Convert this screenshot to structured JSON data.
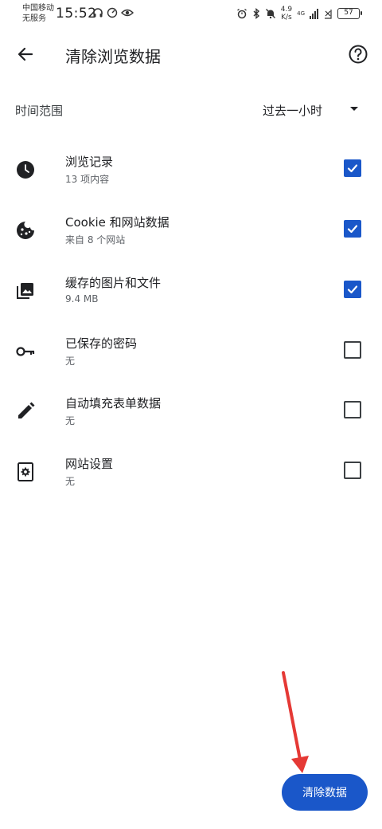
{
  "status_bar": {
    "carrier_line1": "中国移动",
    "carrier_line2": "无服务",
    "time": "15:52",
    "net_speed_value": "4.9",
    "net_speed_unit": "K/s",
    "network_type": "4G",
    "battery": "57"
  },
  "app_bar": {
    "title": "清除浏览数据",
    "back_icon": "arrow-back-icon",
    "help_icon": "help-circle-icon"
  },
  "time_range": {
    "label": "时间范围",
    "value": "过去一小时"
  },
  "options": [
    {
      "title": "浏览记录",
      "subtitle": "13 项内容",
      "icon": "clock-icon",
      "checked": true
    },
    {
      "title": "Cookie 和网站数据",
      "subtitle": "来自 8 个网站",
      "icon": "cookie-icon",
      "checked": true
    },
    {
      "title": "缓存的图片和文件",
      "subtitle": "9.4 MB",
      "icon": "image-icon",
      "checked": true
    },
    {
      "title": "已保存的密码",
      "subtitle": "无",
      "icon": "key-icon",
      "checked": false
    },
    {
      "title": "自动填充表单数据",
      "subtitle": "无",
      "icon": "pencil-icon",
      "checked": false
    },
    {
      "title": "网站设置",
      "subtitle": "无",
      "icon": "site-settings-icon",
      "checked": false
    }
  ],
  "actions": {
    "clear_label": "清除数据"
  },
  "colors": {
    "accent": "#1a57c9",
    "annotation": "#e53935"
  }
}
